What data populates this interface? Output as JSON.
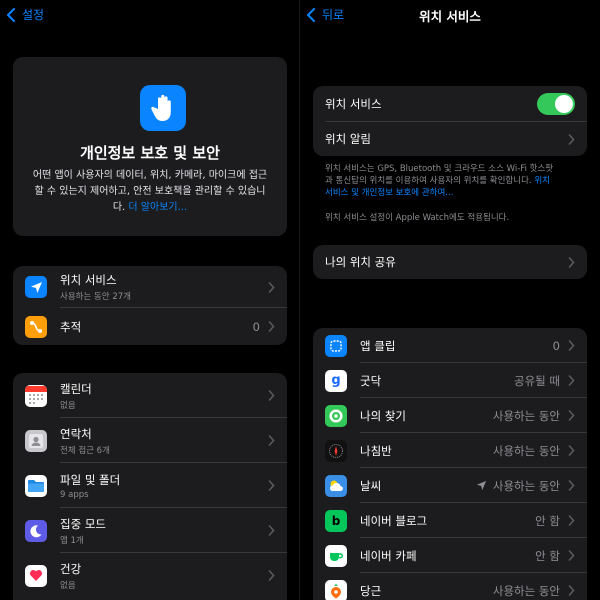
{
  "left": {
    "back_label": "설정",
    "hero": {
      "title": "개인정보 보호 및 보안",
      "description": "어떤 앱이 사용자의 데이터, 위치, 카메라, 마이크에 접근할 수 있는지 제어하고, 안전 보호책을 관리할 수 있습니다.",
      "link": "더 알아보기..."
    },
    "group1": [
      {
        "title": "위치 서비스",
        "subtitle": "사용하는 동안 27개",
        "value": "",
        "icon": "location-arrow-icon",
        "color": "#0a84ff"
      },
      {
        "title": "추적",
        "subtitle": "",
        "value": "0",
        "icon": "tracking-icon",
        "color": "#ff9f0a"
      }
    ],
    "group2": [
      {
        "title": "캘린더",
        "subtitle": "없음",
        "icon": "calendar-icon"
      },
      {
        "title": "연락처",
        "subtitle": "전체 접근 6개",
        "icon": "contacts-icon"
      },
      {
        "title": "파일 및 폴더",
        "subtitle": "9 apps",
        "icon": "folder-icon"
      },
      {
        "title": "집중 모드",
        "subtitle": "앱 1개",
        "icon": "moon-icon"
      },
      {
        "title": "건강",
        "subtitle": "없음",
        "icon": "health-icon"
      }
    ]
  },
  "right": {
    "back_label": "뒤로",
    "title": "위치 서비스",
    "location_services_label": "위치 서비스",
    "location_services_on": true,
    "location_alerts_label": "위치 알림",
    "footnote1_plain": "위치 서비스는 GPS, Bluetooth 및 크라우드 소스 Wi-Fi 핫스팟과 통신탑의 위치를 이용하여 사용자의 위치를 확인합니다.",
    "footnote1_link": "위치 서비스 및 개인정보 보호에 관하여...",
    "footnote2": "위치 서비스 설정이 Apple Watch에도 적용됩니다.",
    "share_location_label": "나의 위치 공유",
    "apps": [
      {
        "name": "앱 클립",
        "value": "0",
        "icon": "app-clips-icon",
        "arrow": false
      },
      {
        "name": "굿닥",
        "value": "공유될 때",
        "icon": "goodoc-icon",
        "arrow": false
      },
      {
        "name": "나의 찾기",
        "value": "사용하는 동안",
        "icon": "find-my-icon",
        "arrow": false
      },
      {
        "name": "나침반",
        "value": "사용하는 동안",
        "icon": "compass-icon",
        "arrow": false
      },
      {
        "name": "날씨",
        "value": "사용하는 동안",
        "icon": "weather-icon",
        "arrow": true
      },
      {
        "name": "네이버 블로그",
        "value": "안 함",
        "icon": "naver-blog-icon",
        "arrow": false
      },
      {
        "name": "네이버 카페",
        "value": "안 함",
        "icon": "naver-cafe-icon",
        "arrow": false
      },
      {
        "name": "당근",
        "value": "사용하는 동안",
        "icon": "daangn-icon",
        "arrow": false
      }
    ]
  }
}
